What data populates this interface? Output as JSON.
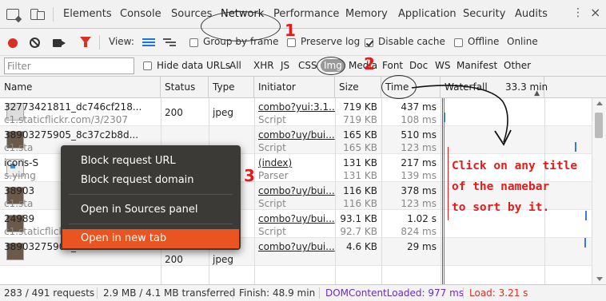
{
  "tabs": [
    "Elements",
    "Console",
    "Sources",
    "Network",
    "Performance",
    "Memory",
    "Application",
    "Security",
    "Audits"
  ],
  "active_tab": "Network",
  "toolbar": {
    "view_label": "View:",
    "group_by_frame": "Group by frame",
    "preserve_log": "Preserve log",
    "disable_cache": "Disable cache",
    "offline": "Offline",
    "throttle": "Online",
    "disable_cache_checked": true
  },
  "filter": {
    "placeholder": "Filter",
    "hide_data_urls": "Hide data URLs",
    "types": [
      "All",
      "XHR",
      "JS",
      "CSS",
      "Img",
      "Media",
      "Font",
      "Doc",
      "WS",
      "Manifest",
      "Other"
    ],
    "selected_type": "Img"
  },
  "columns": {
    "name": "Name",
    "status": "Status",
    "type": "Type",
    "initiator": "Initiator",
    "size": "Size",
    "time": "Time",
    "waterfall": "Waterfall",
    "waterfall_scale": "33.3 min"
  },
  "rows": [
    {
      "name": "32773421811_dc746cf218...",
      "path": "c1.staticflickr.com/3/2307",
      "status": "200",
      "type": "jpeg",
      "initiator": "combo?yui:3.1...",
      "initiator_sub": "Script",
      "size": "719 KB",
      "size_sub": "719 KB",
      "time": "437 ms",
      "time_sub": "108 ms",
      "thumb": "light"
    },
    {
      "name": "38903275905_8c37c2b8d...",
      "path": "c1.sta",
      "status": "",
      "type": "",
      "initiator": "combo?uy/bui...",
      "initiator_sub": "Script",
      "size": "165 KB",
      "size_sub": "165 KB",
      "time": "510 ms",
      "time_sub": "123 ms",
      "thumb": "dark"
    },
    {
      "name": "icons-S",
      "path": "s.yimg",
      "status": "",
      "type": "",
      "initiator": "(index)",
      "initiator_sub": "Parser",
      "size": "131 KB",
      "size_sub": "131 KB",
      "time": "217 ms",
      "time_sub": "139 ms",
      "thumb": "icons"
    },
    {
      "name": "38903",
      "path": "c1.sta",
      "status": "",
      "type": "",
      "initiator": "combo?uy/bui...",
      "initiator_sub": "Script",
      "size": "116 KB",
      "size_sub": "116 KB",
      "time": "378 ms",
      "time_sub": "123 ms",
      "thumb": "dark"
    },
    {
      "name": "24989",
      "path": "c1.staticflickr.com/5/4653",
      "status": "",
      "type": "",
      "initiator": "combo?uy/bui...",
      "initiator_sub": "Script",
      "size": "93.1 KB",
      "size_sub": "92.7 KB",
      "time": "1.02 s",
      "time_sub": "824 ms",
      "thumb": "dark"
    },
    {
      "name": "38903275905_8c37c2b8d...",
      "path": "",
      "status": "200",
      "type": "jpeg",
      "initiator": "combo?uy/bui...",
      "initiator_sub": "",
      "size": "4.6 KB",
      "size_sub": "",
      "time": "29 ms",
      "time_sub": "",
      "thumb": "dark"
    }
  ],
  "context_menu": {
    "items": [
      "Block request URL",
      "Block request domain",
      "Open in Sources panel",
      "Open in new tab"
    ],
    "highlighted": "Open in new tab"
  },
  "status_bar": {
    "requests": "283 / 491 requests",
    "transferred": "2.9 MB / 4.1 MB transferred",
    "finish": "Finish: 48.9 min",
    "dom_content_loaded": "DOMContentLoaded: 977 ms",
    "load": "Load: 3.21 s",
    "dcl_color": "#6a2cc9",
    "load_color": "#d93025"
  },
  "annotations": {
    "num1": "1",
    "num2": "2",
    "num3": "3",
    "note_lines": [
      "Click on any title",
      "of the namebar",
      "to sort by it."
    ],
    "color": "#e31b1b"
  }
}
